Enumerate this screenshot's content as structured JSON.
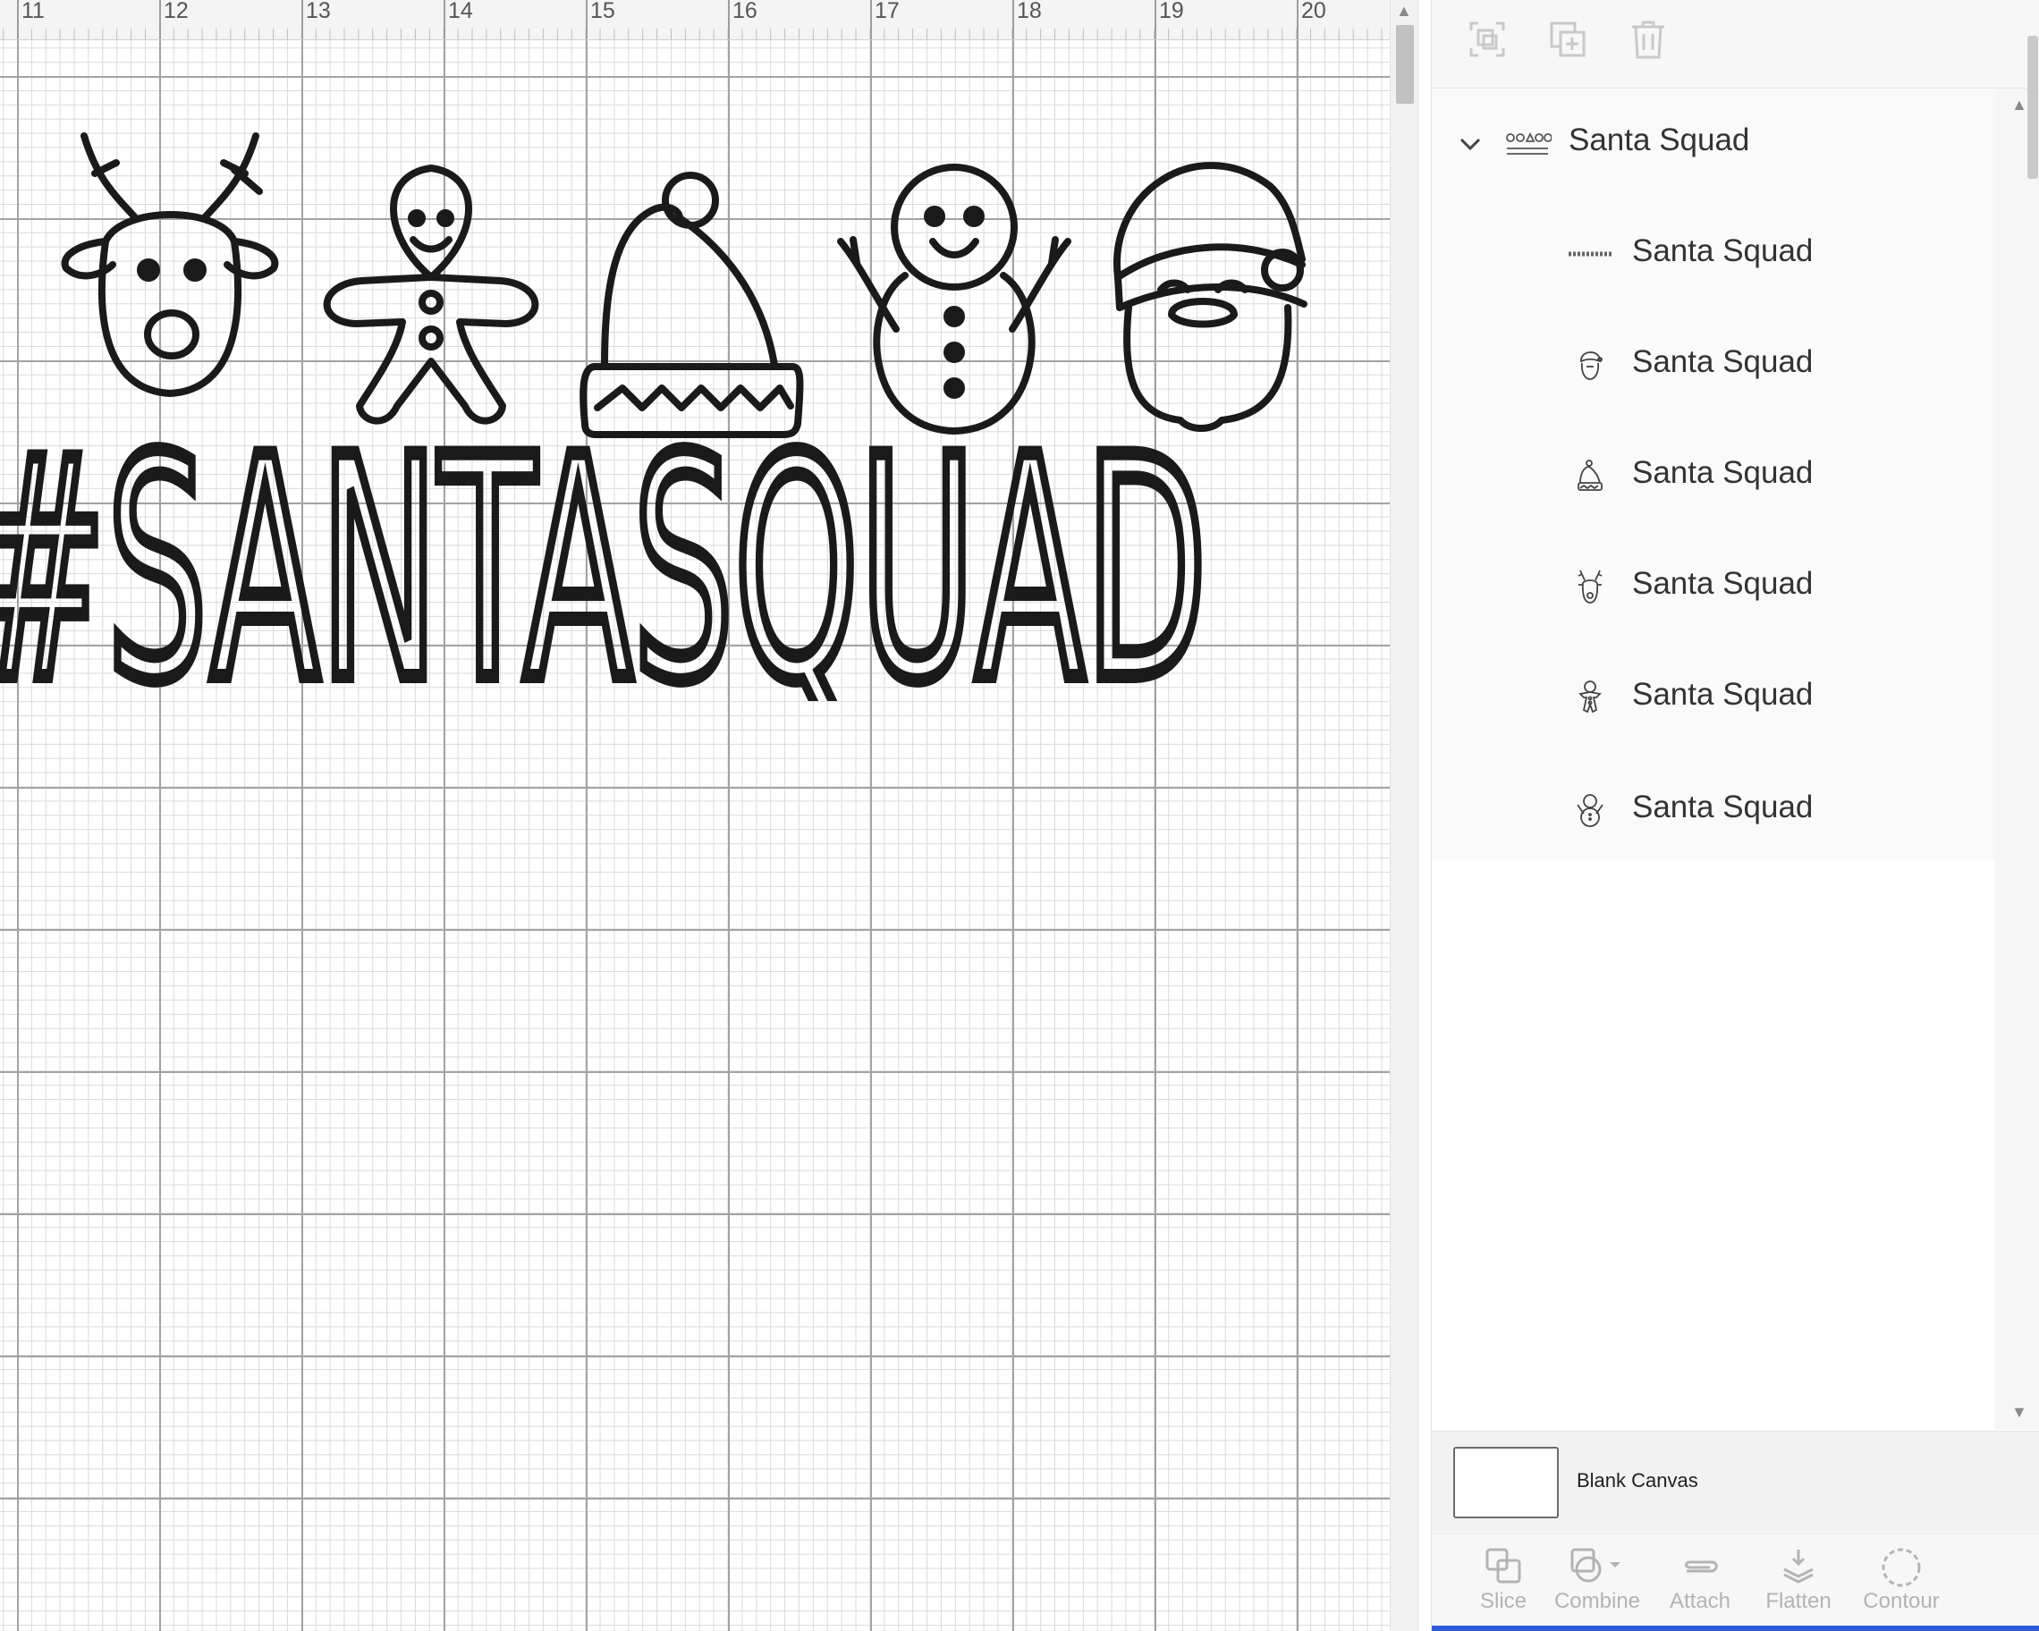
{
  "ruler": {
    "marks": [
      "11",
      "12",
      "13",
      "14",
      "15",
      "16",
      "17",
      "18",
      "19",
      "20"
    ]
  },
  "design": {
    "text": "#SANTASQUAD"
  },
  "panel_toolbar": {
    "icons": [
      "group-icon",
      "duplicate-icon",
      "delete-icon"
    ]
  },
  "layers": {
    "group": {
      "label": "Santa Squad",
      "thumb": "santa-squad-group-thumb-icon"
    },
    "children": [
      {
        "label": "Santa Squad",
        "thumb": "santasquad-text-thumb-icon"
      },
      {
        "label": "Santa Squad",
        "thumb": "santa-face-thumb-icon"
      },
      {
        "label": "Santa Squad",
        "thumb": "santa-hat-thumb-icon"
      },
      {
        "label": "Santa Squad",
        "thumb": "reindeer-thumb-icon"
      },
      {
        "label": "Santa Squad",
        "thumb": "gingerbread-thumb-icon"
      },
      {
        "label": "Santa Squad",
        "thumb": "snowman-thumb-icon"
      }
    ]
  },
  "blank_canvas": {
    "label": "Blank Canvas"
  },
  "bottom_toolbar": {
    "slice": "Slice",
    "combine": "Combine",
    "attach": "Attach",
    "flatten": "Flatten",
    "contour": "Contour"
  },
  "colors": {
    "accent": "#2d5bd8",
    "ink": "#1a1a1a",
    "disabled": "#b3b3b3"
  }
}
